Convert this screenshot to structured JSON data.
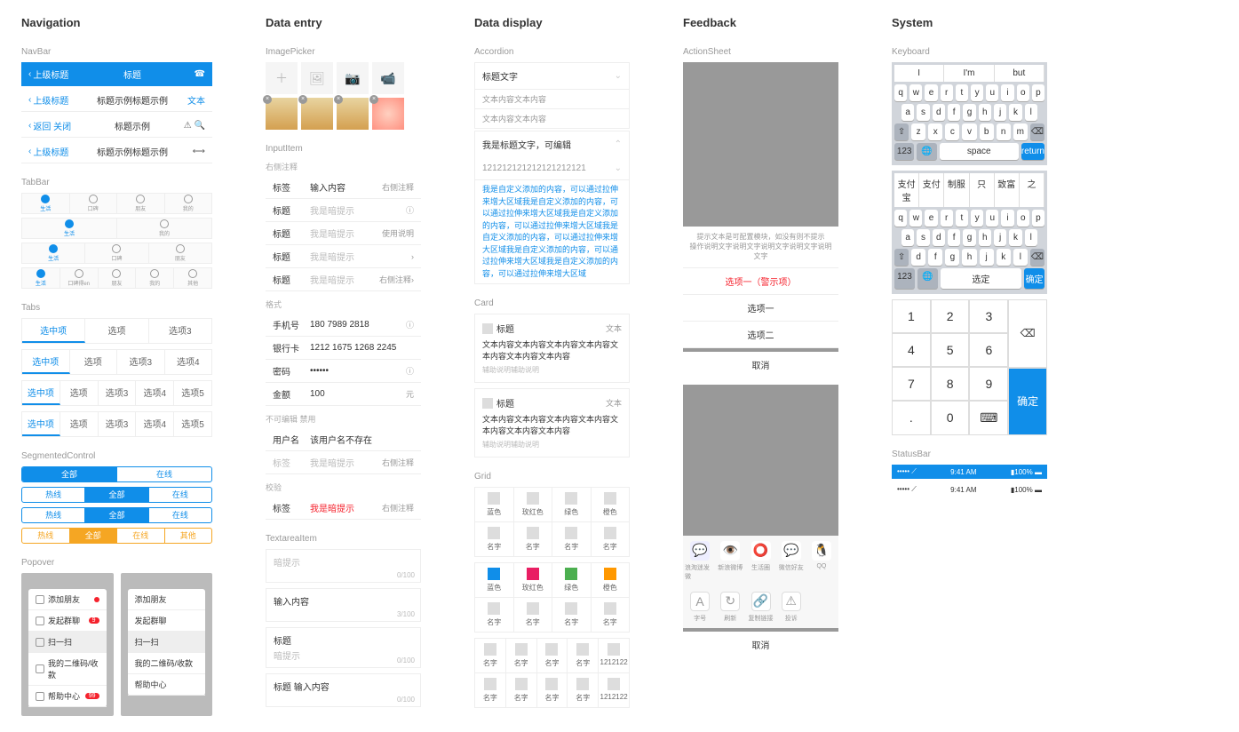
{
  "headings": {
    "nav": "Navigation",
    "entry": "Data entry",
    "display": "Data display",
    "feedback": "Feedback",
    "system": "System"
  },
  "sub": {
    "navbar": "NavBar",
    "tabbar": "TabBar",
    "tabs": "Tabs",
    "seg": "SegmentedControl",
    "popover": "Popover",
    "imagepicker": "ImagePicker",
    "inputitem": "InputItem",
    "textarea": "TextareaItem",
    "accordion": "Accordion",
    "card": "Card",
    "grid": "Grid",
    "actionsheet": "ActionSheet",
    "keyboard": "Keyboard",
    "statusbar": "StatusBar"
  },
  "navbar": [
    {
      "left": "上级标题",
      "title": "标题",
      "style": "blue",
      "rightIcon": "☎"
    },
    {
      "left": "上级标题",
      "title": "标题示例标题示例",
      "style": "white",
      "right": "文本"
    },
    {
      "left": "返回 关闭",
      "title": "标题示例",
      "style": "white",
      "rightIcons": "⚠ 🔍"
    },
    {
      "left": "上级标题",
      "title": "标题示例标题示例",
      "style": "white",
      "rightIcon": "⟷"
    }
  ],
  "tabbar": {
    "items": [
      "生活",
      "口碑",
      "朋友",
      "我的"
    ],
    "extra": [
      "生活",
      "口碑得en",
      "朋友",
      "我的",
      "其他"
    ]
  },
  "tabs": {
    "row1": [
      "选中项",
      "选项",
      "选项3"
    ],
    "row2": [
      "选中项",
      "选项",
      "选项3",
      "选项4"
    ],
    "row3": [
      "选中项",
      "选项",
      "选项3",
      "选项4",
      "选项5"
    ],
    "row4": [
      "选中项",
      "选项",
      "选项3",
      "选项4",
      "选项5"
    ]
  },
  "seg": {
    "s1": [
      "全部",
      "在线"
    ],
    "s2": [
      "热线",
      "全部",
      "在线"
    ],
    "s3": [
      "热线",
      "全部",
      "在线"
    ],
    "s4": [
      "热线",
      "全部",
      "在线",
      "其他"
    ]
  },
  "popover": {
    "items": [
      "添加朋友",
      "发起群聊",
      "扫一扫",
      "我的二维码/收款",
      "帮助中心"
    ]
  },
  "input": {
    "h1": "右侧注释",
    "h2": "格式",
    "h3": "不可编辑 禁用",
    "h4": "校验",
    "rows": [
      {
        "lbl": "标签",
        "val": "输入内容",
        "ext": "右侧注释"
      },
      {
        "lbl": "标题",
        "ph": "我是暗提示",
        "info": true
      },
      {
        "lbl": "标题",
        "ph": "我是暗提示",
        "ext": "使用说明",
        "extLink": true
      },
      {
        "lbl": "标题",
        "ph": "我是暗提示",
        "arrow": true
      },
      {
        "lbl": "标题",
        "ph": "我是暗提示",
        "ext": "右侧注释",
        "arrow": true
      }
    ],
    "fmt": [
      {
        "lbl": "手机号",
        "val": "180 7989 2818",
        "info": true
      },
      {
        "lbl": "银行卡",
        "val": "1212 1675 1268 2245"
      },
      {
        "lbl": "密码",
        "val": "••••••",
        "info": true
      },
      {
        "lbl": "金额",
        "val": "100",
        "ext": "元"
      }
    ],
    "dis": [
      {
        "lbl": "用户名",
        "val": "该用户名不存在"
      },
      {
        "lbl": "标签",
        "ph": "我是暗提示",
        "ext": "右侧注释",
        "disabled": true
      }
    ],
    "err": [
      {
        "lbl": "标签",
        "err": "我是暗提示",
        "ext": "右侧注释"
      }
    ]
  },
  "textarea": [
    {
      "ph": "暗提示",
      "cnt": "0/100"
    },
    {
      "val": "输入内容",
      "cnt": "3/100"
    },
    {
      "ttl": "标题",
      "ph": "暗提示",
      "cnt": "0/100"
    },
    {
      "ttl": "标题",
      "val": "输入内容",
      "cnt": "0/100"
    }
  ],
  "accordion": [
    {
      "title": "标题文字",
      "body": [
        "文本内容文本内容",
        "文本内容文本内容"
      ],
      "open": true
    },
    {
      "title": "我是标题文字，可编辑",
      "sub": "121212121212121212121",
      "body": [
        "我是自定义添加的内容，可以通过拉伸来增大区域我是自定义添加的内容，可以通过拉伸来增大区域我是自定义添加的内容，可以通过拉伸来增大区域我是自定义添加的内容，可以通过拉伸来增大区域我是自定义添加的内容，可以通过拉伸来增大区域我是自定义添加的内容，可以通过拉伸来增大区域"
      ],
      "open": true,
      "blue": true
    }
  ],
  "cards": [
    {
      "title": "标题",
      "ext": "文本",
      "body": "文本内容文本内容文本内容文本内容文本内容文本内容文本内容",
      "foot": "辅助说明辅助说明"
    },
    {
      "title": "标题",
      "ext": "文本",
      "body": "文本内容文本内容文本内容文本内容文本内容文本内容文本内容",
      "foot": "辅助说明辅助说明"
    }
  ],
  "grid": {
    "g1": {
      "items": [
        "蓝色",
        "玫红色",
        "绿色",
        "橙色",
        "名字",
        "名字",
        "名字",
        "名字"
      ]
    },
    "g2": {
      "items": [
        "蓝色",
        "玫红色",
        "绿色",
        "橙色",
        "名字",
        "名字",
        "名字",
        "名字"
      ],
      "colored": true
    },
    "g3": {
      "items": [
        "名字",
        "名字",
        "名字",
        "名字",
        "1212122",
        "名字",
        "名字",
        "名字",
        "名字",
        "1212122"
      ]
    }
  },
  "actionsheet": {
    "msg1": "提示文本是可配置模块，如没有则不提示",
    "msg2": "操作说明文字说明文字说明文字说明文字说明文字",
    "items": [
      "选项一（警示项）",
      "选项一",
      "选项二"
    ],
    "cancel": "取消",
    "share1": [
      "浪淘迷发微",
      "新浪微博",
      "生活圈",
      "微信好友",
      "QQ"
    ],
    "share2": [
      "字号",
      "刷新",
      "复制链接",
      "投诉"
    ]
  },
  "keyboard": {
    "sug": [
      "I",
      "I'm",
      "but"
    ],
    "r1": [
      "q",
      "w",
      "e",
      "r",
      "t",
      "y",
      "u",
      "i",
      "o",
      "p"
    ],
    "r2": [
      "a",
      "s",
      "d",
      "f",
      "g",
      "h",
      "j",
      "k",
      "l"
    ],
    "r3": [
      "⇧",
      "z",
      "x",
      "c",
      "v",
      "b",
      "n",
      "m",
      "⌫"
    ],
    "r4": [
      "123",
      "🌐",
      "space",
      "return"
    ],
    "cn_sug": [
      "支付宝",
      "支付",
      "制服",
      "只",
      "致富",
      "之"
    ],
    "cn_r3": [
      "⇧",
      "d",
      "f",
      "g",
      "h",
      "j",
      "k",
      "l",
      "⌫"
    ],
    "cn_r4": [
      "123",
      "🌐",
      "选定",
      "确定"
    ],
    "num": [
      "1",
      "2",
      "3",
      "4",
      "5",
      "6",
      "7",
      "8",
      "9",
      ".",
      "0",
      "⌨"
    ],
    "num_del": "⌫",
    "num_ok": "确定"
  },
  "status": {
    "time": "9:41 AM",
    "batt": "100%"
  }
}
